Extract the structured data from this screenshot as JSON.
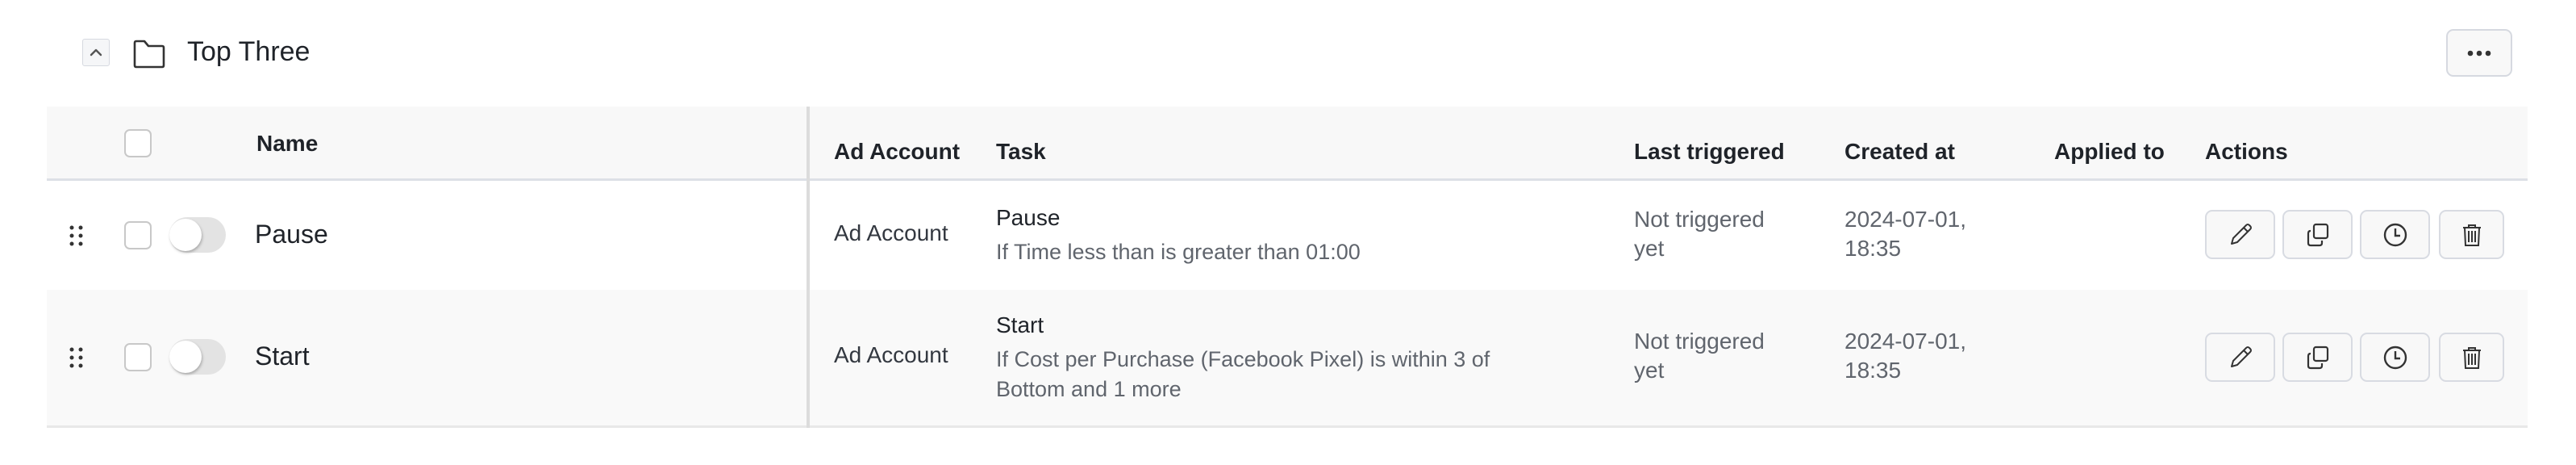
{
  "group": {
    "title": "Top Three",
    "collapse_icon": "chevron-up-icon",
    "folder_icon": "folder-icon",
    "more_icon": "ellipsis-icon"
  },
  "table": {
    "columns": {
      "name": "Name",
      "ad_account": "Ad Account",
      "task": "Task",
      "last_triggered": "Last triggered",
      "created_at": "Created at",
      "applied_to": "Applied to",
      "actions": "Actions"
    },
    "rows": [
      {
        "name": "Pause",
        "enabled": false,
        "checked": false,
        "ad_account": "Ad Account",
        "task_title": "Pause",
        "task_condition": "If Time less than is greater than 01:00",
        "last_triggered": "Not triggered yet",
        "created_at_date": "2024-07-01,",
        "created_at_time": "18:35",
        "applied_to": ""
      },
      {
        "name": "Start",
        "enabled": false,
        "checked": false,
        "ad_account": "Ad Account",
        "task_title": "Start",
        "task_condition": "If Cost per Purchase (Facebook Pixel) is within 3 of Bottom and 1 more",
        "last_triggered": "Not triggered yet",
        "created_at_date": "2024-07-01,",
        "created_at_time": "18:35",
        "applied_to": ""
      }
    ],
    "action_icons": [
      "pencil-icon",
      "copy-icon",
      "clock-icon",
      "trash-icon"
    ]
  },
  "colors": {
    "header_bg": "#f8f8f8",
    "alt_row_bg": "#f9f9f9",
    "border": "#dde0e6",
    "text": "#1f2329",
    "muted_text": "#60656d",
    "toggle_off": "#e3e3e3"
  }
}
